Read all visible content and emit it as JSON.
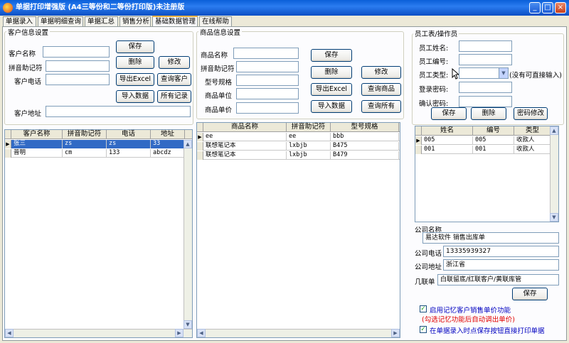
{
  "window": {
    "title": "单据打印增强版 (A4三等份和二等份打印版)未注册版",
    "min": "_",
    "max": "□",
    "close": "×"
  },
  "tabs": [
    "单据录入",
    "单据明细查询",
    "单据汇总",
    "销售分析",
    "基础数据管理",
    "在线帮助"
  ],
  "customer": {
    "group_label": "客户信息设置",
    "labels": {
      "name": "客户名称",
      "pinyin": "拼音助记符",
      "phone": "客户电话",
      "address": "客户地址"
    },
    "buttons": {
      "save": "保存",
      "delete": "删除",
      "modify": "修改",
      "export": "导出Excel",
      "query": "查询客户",
      "import": "导入数据",
      "all": "所有记录"
    },
    "grid": {
      "columns": [
        "客户名称",
        "拼音助记符",
        "电话",
        "地址"
      ],
      "rows": [
        [
          "张三",
          "zs",
          "zs",
          "33"
        ],
        [
          "普明",
          "cm",
          "133",
          "abcdz"
        ]
      ]
    }
  },
  "product": {
    "group_label": "商品信息设置",
    "labels": {
      "name": "商品名称",
      "pinyin": "拼音助记符",
      "model": "型号规格",
      "unit": "商品单位",
      "price": "商品单价"
    },
    "buttons": {
      "save": "保存",
      "delete": "删除",
      "modify": "修改",
      "export": "导出Excel",
      "query": "查询商品",
      "import": "导入数据",
      "all": "查询所有"
    },
    "grid": {
      "columns": [
        "商品名称",
        "拼音助记符",
        "型号规格"
      ],
      "rows": [
        [
          "ee",
          "ee",
          "bbb"
        ],
        [
          "联想笔记本",
          "lxbjb",
          "B475"
        ],
        [
          "联想笔记本",
          "lxbjb",
          "B479"
        ]
      ]
    }
  },
  "employee": {
    "group_label": "员工表/操作员",
    "labels": {
      "name": "员工姓名:",
      "id": "员工编号:",
      "type": "员工类型:",
      "type_hint": "(没有可直接输入)",
      "password": "登录密码:",
      "confirm": "确认密码:"
    },
    "buttons": {
      "save": "保存",
      "delete": "删除",
      "change_pw": "密码修改"
    },
    "grid": {
      "columns": [
        "姓名",
        "编号",
        "类型"
      ],
      "rows": [
        [
          "005",
          "005",
          "收款人"
        ],
        [
          "001",
          "001",
          "收款人"
        ]
      ]
    }
  },
  "company": {
    "name_label": "公司名称",
    "name": "易达软件 销售出库单",
    "phone_label": "公司电话",
    "phone": "13335939327",
    "address_label": "公司地址",
    "address": "浙江省",
    "copies_label": "几联单",
    "copies": "白联留底/红联客户/黄联库管",
    "save": "保存",
    "opt1": "启用记忆客户销售单价功能",
    "opt1_note": "(勾选记忆功能后自动调出单价)",
    "opt2": "在单据录入时点保存按钮直接打印单据"
  }
}
